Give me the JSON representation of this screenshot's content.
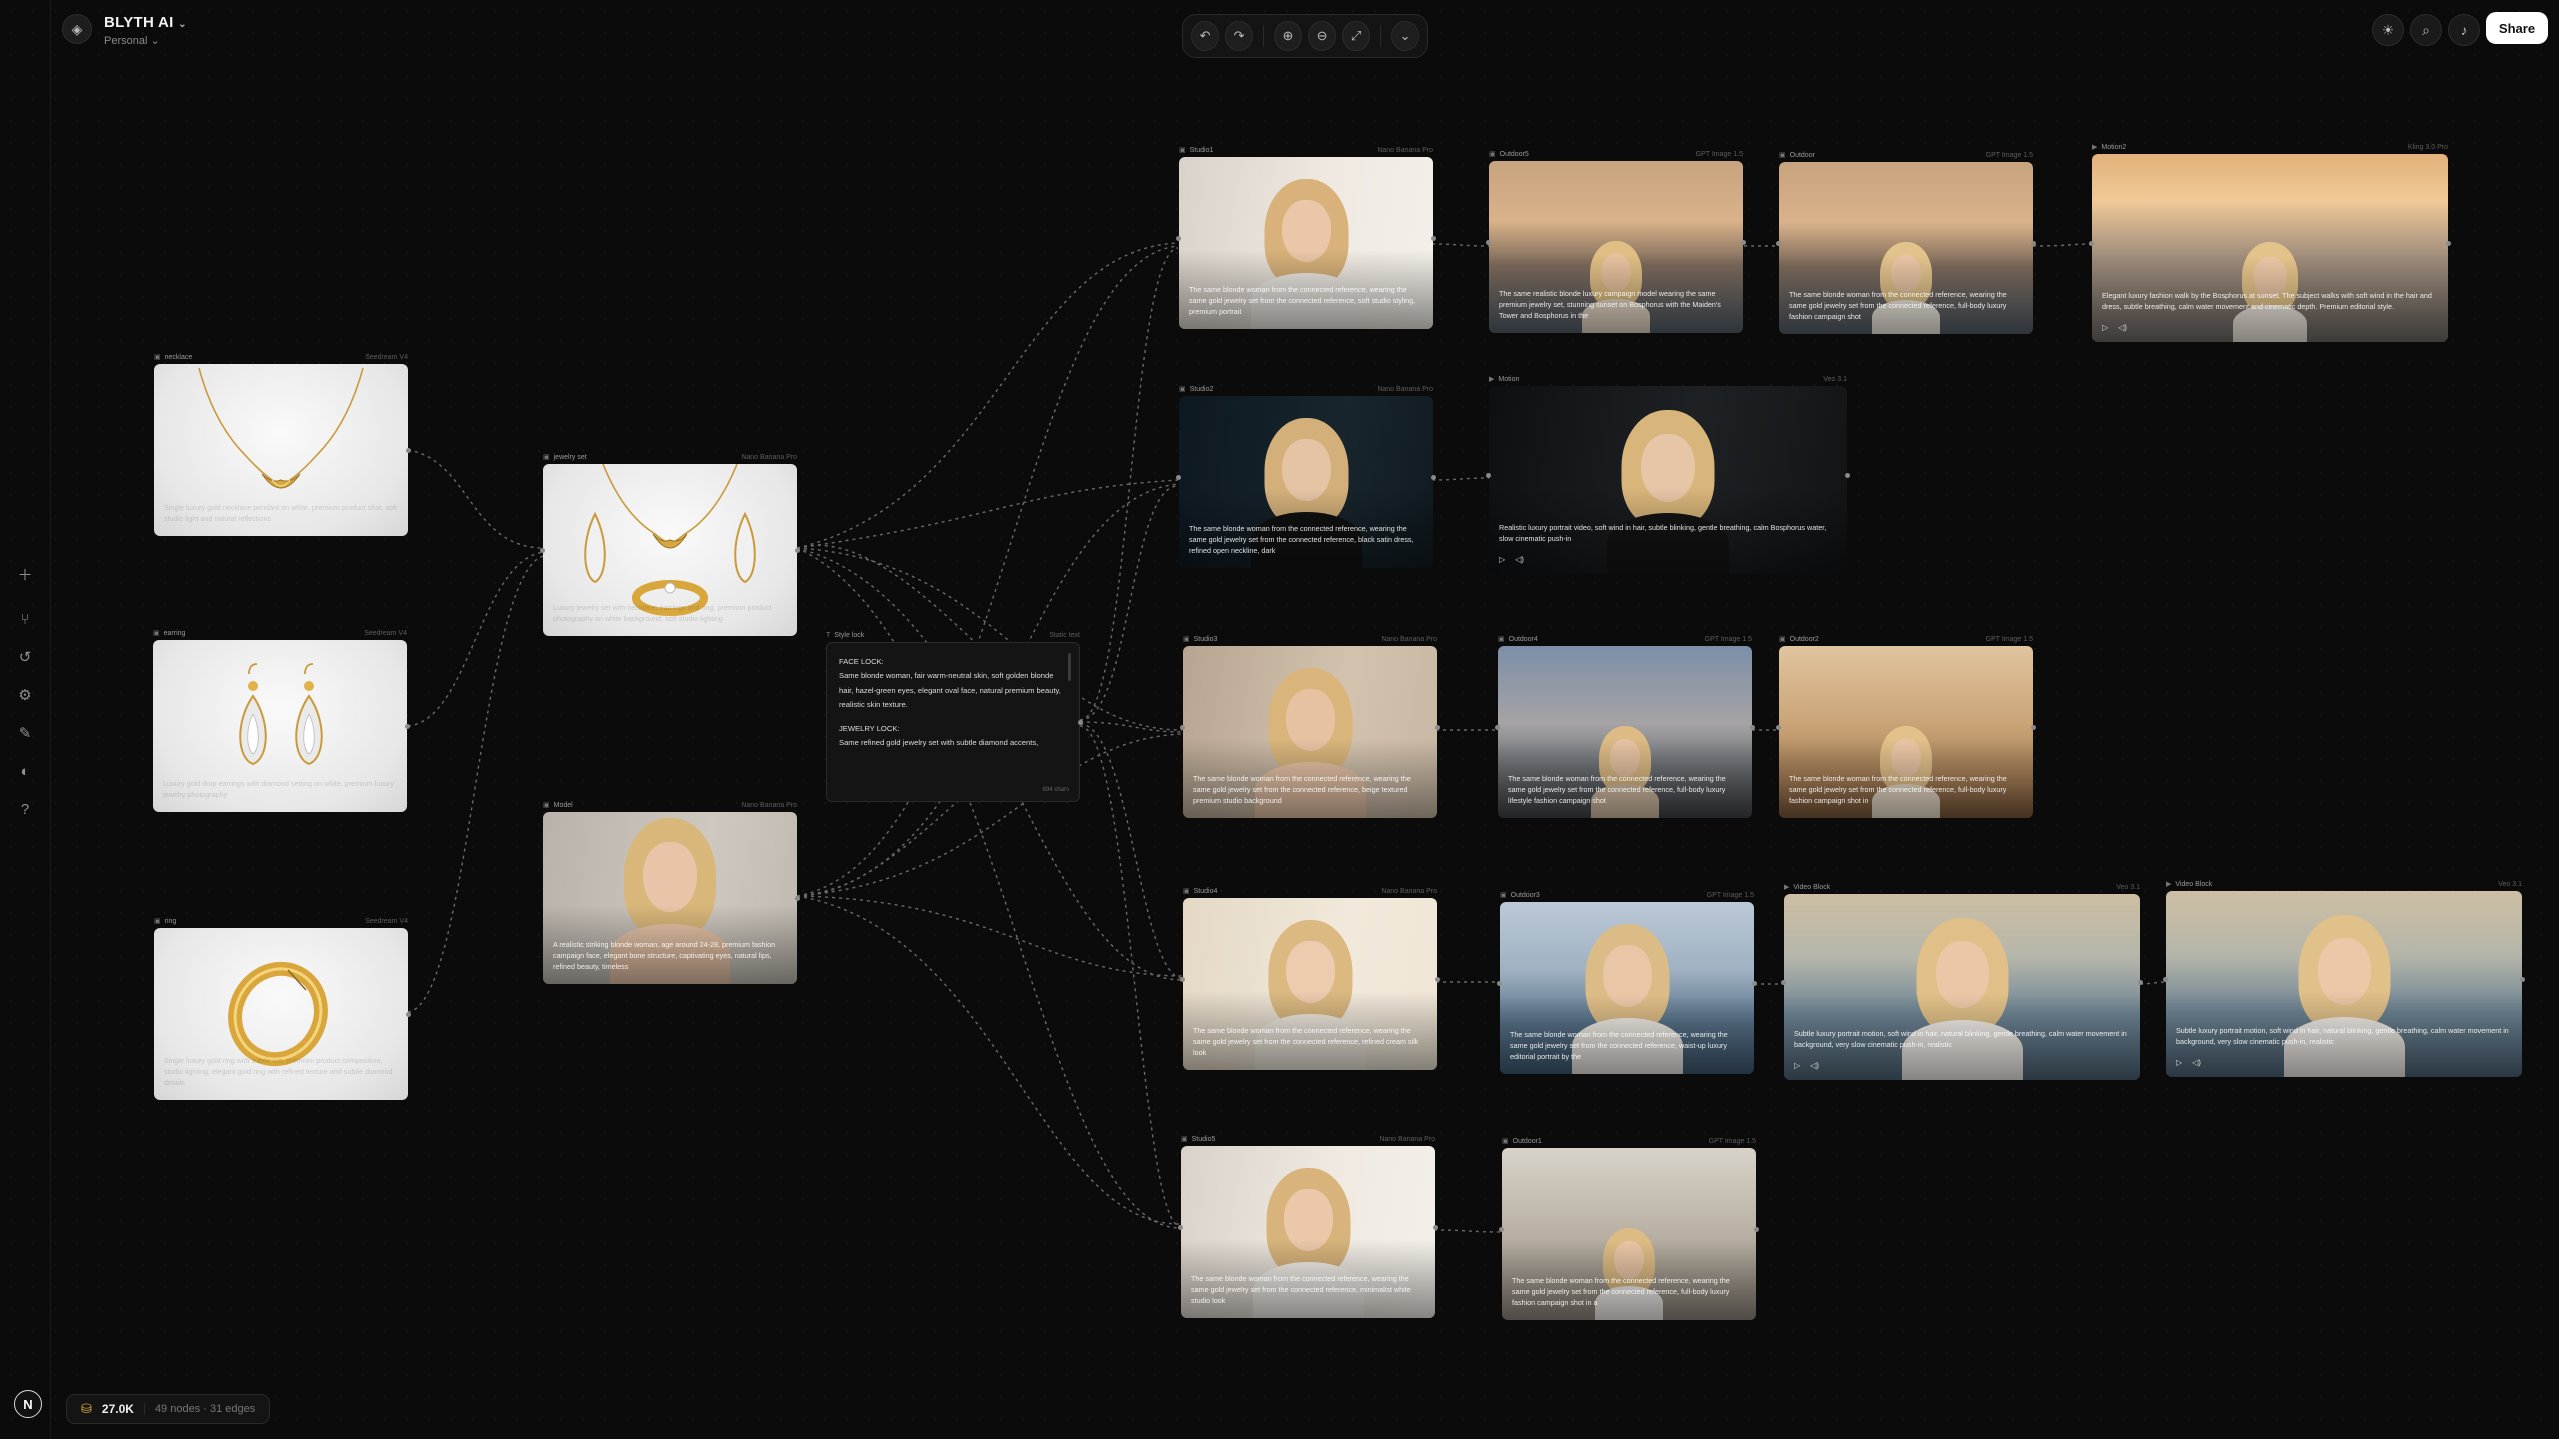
{
  "app": {
    "name": "BLYTH AI",
    "workspace": "Personal"
  },
  "toolbar": {
    "undo": "↶",
    "redo": "↷",
    "zoom_in": "⊕",
    "zoom_out": "⊖",
    "fit": "⤢",
    "more": "⌄"
  },
  "topbar": {
    "share_label": "Share"
  },
  "footer": {
    "credits": "27.0K",
    "stats": "49 nodes · 31 edges",
    "avatar_letter": "N"
  },
  "nodes": {
    "necklace": {
      "title": "necklace",
      "model": "Seedream V4",
      "prompt": "Single luxury gold necklace pendant on white, premium product shot, soft studio light and natural reflections"
    },
    "earring": {
      "title": "earring",
      "model": "Seedream V4",
      "prompt": "Luxury gold drop earrings with diamond setting on white, premium luxury jewelry photography"
    },
    "ring": {
      "title": "ring",
      "model": "Seedream V4",
      "prompt": "Single luxury gold ring with subtle cut, premium product composition, studio lighting, elegant gold ring with refined texture and subtle diamond details"
    },
    "jewelry_set": {
      "title": "jewelry set",
      "model": "Nano Banana Pro",
      "prompt": "Luxury jewelry set with necklace, earrings and ring, premium product photography on white background, soft studio lighting"
    },
    "model": {
      "title": "Model",
      "model": "Nano Banana Pro",
      "prompt": "A realistic striking blonde woman, age around 24-28, premium fashion campaign face, elegant bone structure, captivating eyes, natural lips, refined beauty, timeless"
    },
    "style_lock": {
      "title": "Style lock",
      "model": "Static text",
      "face_lock_title": "FACE LOCK:",
      "face_lock_text": "Same blonde woman, fair warm-neutral skin, soft golden blonde hair, hazel-green eyes, elegant oval face, natural premium beauty, realistic skin texture.",
      "jewelry_lock_title": "JEWELRY LOCK:",
      "jewelry_lock_text": "Same refined gold jewelry set with subtle diamond accents,",
      "count": "894 chars"
    },
    "studio1": {
      "title": "Studio1",
      "model": "Nano Banana Pro",
      "prompt": "The same blonde woman from the connected reference, wearing the same gold jewelry set from the connected reference, soft studio styling, premium portrait"
    },
    "studio2": {
      "title": "Studio2",
      "model": "Nano Banana Pro",
      "prompt": "The same blonde woman from the connected reference, wearing the same gold jewelry set from the connected reference, black satin dress, refined open neckline, dark"
    },
    "studio3": {
      "title": "Studio3",
      "model": "Nano Banana Pro",
      "prompt": "The same blonde woman from the connected reference, wearing the same gold jewelry set from the connected reference, beige textured premium studio background"
    },
    "studio4": {
      "title": "Studio4",
      "model": "Nano Banana Pro",
      "prompt": "The same blonde woman from the connected reference, wearing the same gold jewelry set from the connected reference, refined cream silk look"
    },
    "studio5": {
      "title": "Studio5",
      "model": "Nano Banana Pro",
      "prompt": "The same blonde woman from the connected reference, wearing the same gold jewelry set from the connected reference, minimalist white studio look"
    },
    "outdoor5": {
      "title": "Outdoor5",
      "model": "GPT Image 1.5",
      "prompt": "The same realistic blonde luxury campaign model wearing the same premium jewelry set, stunning sunset on Bosphorus with the Maiden's Tower and Bosphorus in the"
    },
    "outdoor": {
      "title": "Outdoor",
      "model": "GPT Image 1.5",
      "prompt": "The same blonde woman from the connected reference, wearing the same gold jewelry set from the connected reference, full-body luxury fashion campaign shot"
    },
    "motion2": {
      "title": "Motion2",
      "model": "Kling 3.0 Pro",
      "prompt": "Elegant luxury fashion walk by the Bosphorus at sunset. The subject walks with soft wind in the hair and dress, subtle breathing, calm water movement and cinematic depth. Premium editorial style."
    },
    "motion": {
      "title": "Motion",
      "model": "Veo 3.1",
      "prompt": "Realistic luxury portrait video, soft wind in hair, subtle blinking, gentle breathing, calm Bosphorus water, slow cinematic push-in"
    },
    "outdoor4": {
      "title": "Outdoor4",
      "model": "GPT Image 1.5",
      "prompt": "The same blonde woman from the connected reference, wearing the same gold jewelry set from the connected reference, full-body luxury lifestyle fashion campaign shot"
    },
    "outdoor2": {
      "title": "Outdoor2",
      "model": "GPT Image 1.5",
      "prompt": "The same blonde woman from the connected reference, wearing the same gold jewelry set from the connected reference, full-body luxury fashion campaign shot in"
    },
    "outdoor3": {
      "title": "Outdoor3",
      "model": "GPT Image 1.5",
      "prompt": "The same blonde woman from the connected reference, wearing the same gold jewelry set from the connected reference, waist-up luxury editorial portrait by the"
    },
    "video_block_a": {
      "title": "Video Block",
      "model": "Veo 3.1",
      "prompt": "Subtle luxury portrait motion, soft wind in hair, natural blinking, gentle breathing, calm water movement in background, very slow cinematic push-in, realistic"
    },
    "video_block_b": {
      "title": "Video Block",
      "model": "Veo 3.1",
      "prompt": "Subtle luxury portrait motion, soft wind in hair, natural blinking, gentle breathing, calm water movement in background, very slow cinematic push-in, realistic"
    },
    "outdoor1": {
      "title": "Outdoor1",
      "model": "GPT Image 1.5",
      "prompt": "The same blonde woman from the connected reference, wearing the same gold jewelry set from the connected reference, full-body luxury fashion campaign shot in a"
    }
  },
  "colors": {
    "canvas": "#0b0b0b",
    "accent": "#ffffff",
    "edge": "#8a8a8a",
    "gold": "#d9a93c"
  }
}
